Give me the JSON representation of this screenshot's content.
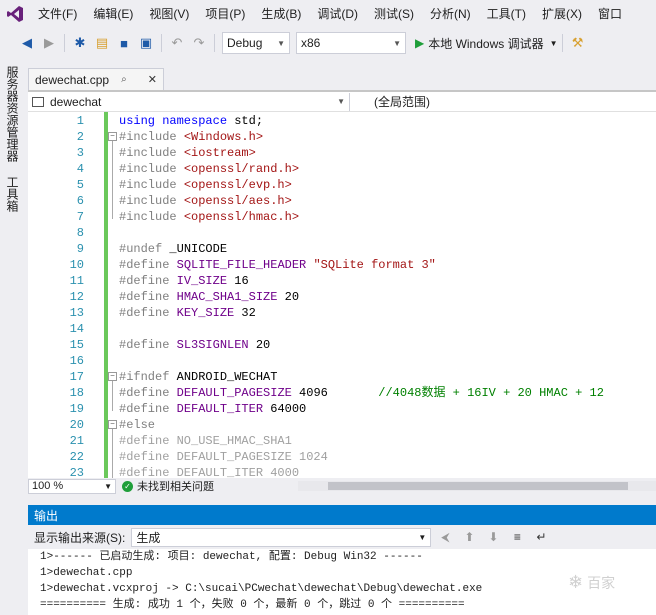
{
  "menu": [
    "文件(F)",
    "编辑(E)",
    "视图(V)",
    "项目(P)",
    "生成(B)",
    "调试(D)",
    "测试(S)",
    "分析(N)",
    "工具(T)",
    "扩展(X)",
    "窗口"
  ],
  "toolbar": {
    "config": "Debug",
    "platform": "x86",
    "run_label": "本地 Windows 调试器"
  },
  "side_tabs": [
    "服务器资源管理器",
    "工具箱"
  ],
  "document_tab": {
    "label": "dewechat.cpp"
  },
  "navbar": {
    "scope": "dewechat",
    "function": "(全局范围)"
  },
  "editor": {
    "lines": [
      {
        "n": "1",
        "t": "using namespace std;"
      },
      {
        "n": "2",
        "t": "#include <Windows.h>"
      },
      {
        "n": "3",
        "t": "#include <iostream>"
      },
      {
        "n": "4",
        "t": "#include <openssl/rand.h>"
      },
      {
        "n": "5",
        "t": "#include <openssl/evp.h>"
      },
      {
        "n": "6",
        "t": "#include <openssl/aes.h>"
      },
      {
        "n": "7",
        "t": "#include <openssl/hmac.h>"
      },
      {
        "n": "8",
        "t": ""
      },
      {
        "n": "9",
        "t": "#undef _UNICODE"
      },
      {
        "n": "10",
        "t": "#define SQLITE_FILE_HEADER \"SQLite format 3\""
      },
      {
        "n": "11",
        "t": "#define IV_SIZE 16"
      },
      {
        "n": "12",
        "t": "#define HMAC_SHA1_SIZE 20"
      },
      {
        "n": "13",
        "t": "#define KEY_SIZE 32"
      },
      {
        "n": "14",
        "t": ""
      },
      {
        "n": "15",
        "t": "#define SL3SIGNLEN 20"
      },
      {
        "n": "16",
        "t": ""
      },
      {
        "n": "17",
        "t": "#ifndef ANDROID_WECHAT"
      },
      {
        "n": "18",
        "t": "#define DEFAULT_PAGESIZE 4096       //4048数据 + 16IV + 20 HMAC + 12"
      },
      {
        "n": "19",
        "t": "#define DEFAULT_ITER 64000"
      },
      {
        "n": "20",
        "t": "#else"
      },
      {
        "n": "21",
        "t": "#define NO_USE_HMAC_SHA1"
      },
      {
        "n": "22",
        "t": "#define DEFAULT_PAGESIZE 1024"
      },
      {
        "n": "23",
        "t": "#define DEFAULT_ITER 4000"
      }
    ]
  },
  "status": {
    "zoom": "100 %",
    "issues": "未找到相关问题"
  },
  "output": {
    "title": "输出",
    "source_label": "显示输出来源(S):",
    "source_value": "生成",
    "lines": [
      "1>------ 已启动生成: 项目: dewechat, 配置: Debug Win32 ------",
      "1>dewechat.cpp",
      "1>dewechat.vcxproj -> C:\\sucai\\PCwechat\\dewechat\\Debug\\dewechat.exe",
      "========== 生成: 成功 1 个，失败 0 个，最新 0 个，跳过 0 个 =========="
    ]
  },
  "watermark": "百家"
}
